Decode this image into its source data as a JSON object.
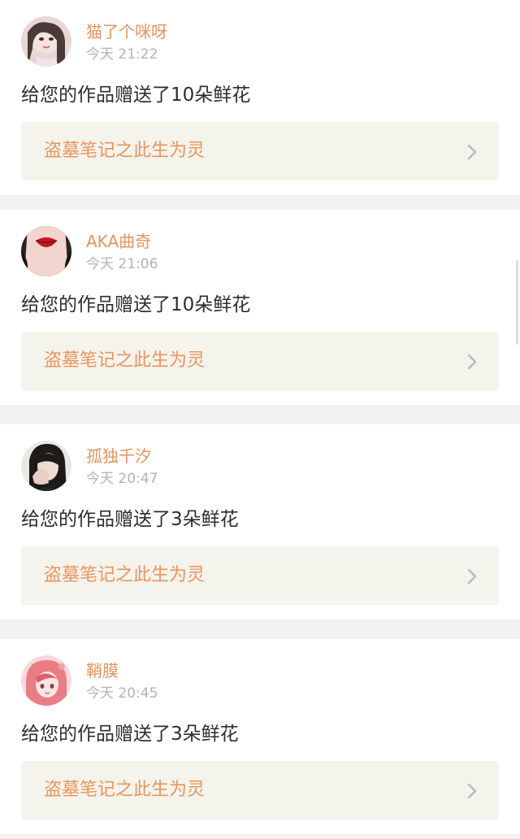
{
  "notifications": [
    {
      "username": "猫了个咪呀",
      "time": "今天 21:22",
      "message": "给您的作品赠送了10朵鲜花",
      "work_title": "盗墓笔记之此生为灵"
    },
    {
      "username": "AKA曲奇",
      "time": "今天 21:06",
      "message": "给您的作品赠送了10朵鲜花",
      "work_title": "盗墓笔记之此生为灵"
    },
    {
      "username": "孤独千汐",
      "time": "今天 20:47",
      "message": "给您的作品赠送了3朵鲜花",
      "work_title": "盗墓笔记之此生为灵"
    },
    {
      "username": "鞘膜",
      "time": "今天 20:45",
      "message": "给您的作品赠送了3朵鲜花",
      "work_title": "盗墓笔记之此生为灵"
    }
  ],
  "icons": {
    "avatar": "avatar-image",
    "arrow": "chevron-right-icon"
  },
  "colors": {
    "username": "#e39460",
    "timestamp": "#b3b3b3",
    "message": "#2d2d2d",
    "work_title": "#e9955e",
    "link_background": "#f4f3ec",
    "page_background": "#f2f2f2"
  }
}
